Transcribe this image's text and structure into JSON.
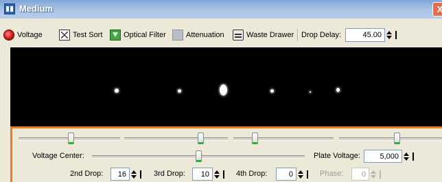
{
  "window": {
    "title": "Medium",
    "close_glyph": "X"
  },
  "toolbar": {
    "voltage_label": "Voltage",
    "test_sort_label": "Test Sort",
    "optical_filter_label": "Optical Filter",
    "attenuation_label": "Attenuation",
    "waste_drawer_label": "Waste Drawer",
    "drop_delay_label": "Drop Delay:",
    "drop_delay_value": "45.00",
    "icons": [
      "voltage-icon",
      "test-sort-icon",
      "optical-filter-icon",
      "attenuation-icon",
      "waste-drawer-icon"
    ]
  },
  "camera": {
    "drops": 6
  },
  "panel": {
    "slider_levels": [
      0.52,
      0.75,
      0.2,
      0.57
    ],
    "voltage_center_label": "Voltage Center:",
    "voltage_center_level": 0.5,
    "plate_voltage_label": "Plate Voltage:",
    "plate_voltage_value": "5,000",
    "second_drop_label": "2nd Drop:",
    "second_drop_value": "16",
    "third_drop_label": "3rd Drop:",
    "third_drop_value": "10",
    "fourth_drop_label": "4th Drop:",
    "fourth_drop_value": "0",
    "phase_label": "Phase:",
    "phase_value": "0"
  },
  "colors": {
    "panel_border": "#ee7b22",
    "thumb_accent": "#23b13f",
    "title_bar": "#a9c2e3"
  }
}
